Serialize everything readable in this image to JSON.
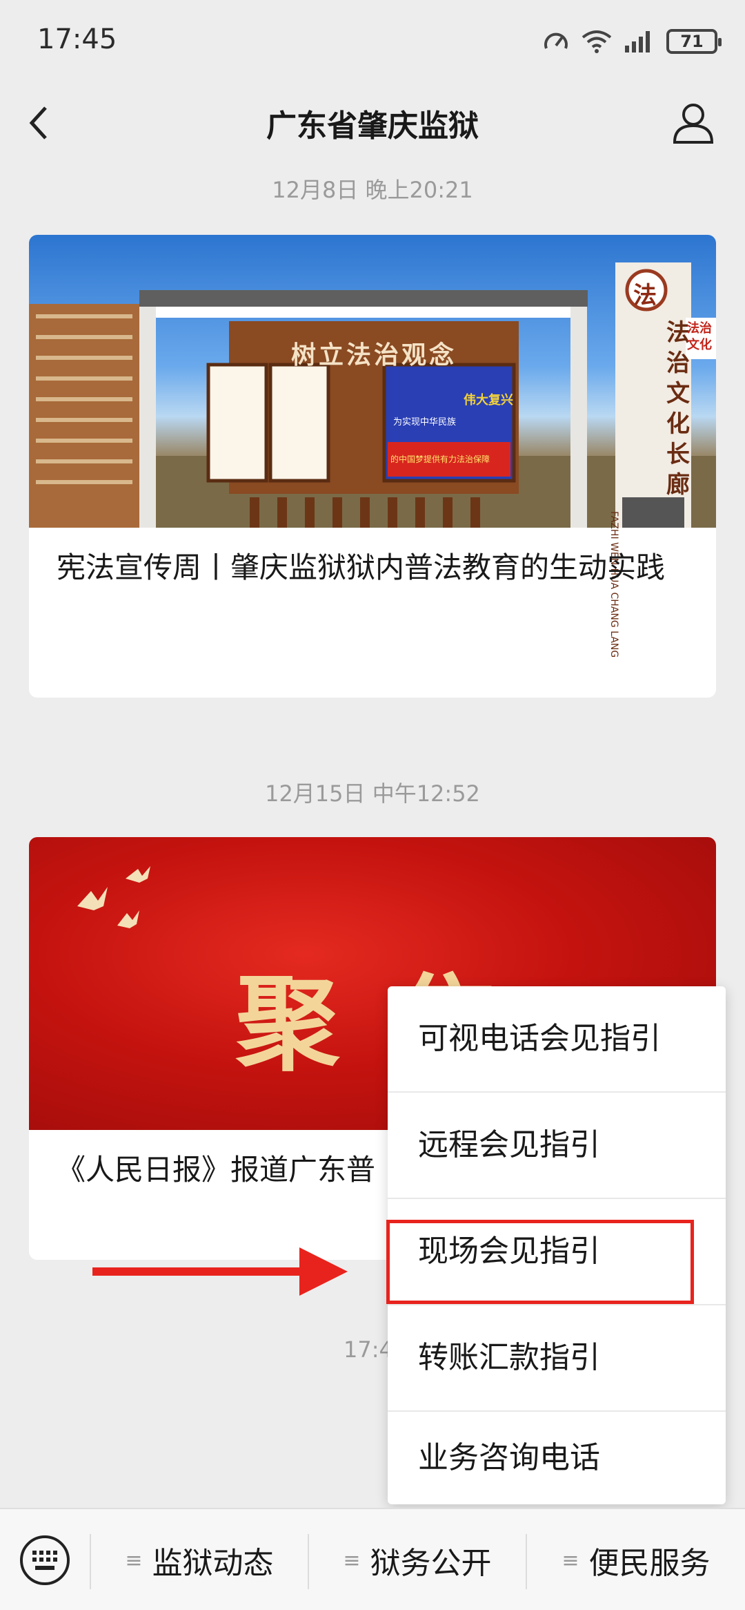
{
  "status": {
    "time": "17:45",
    "battery": "71"
  },
  "header": {
    "title": "广东省肇庆监狱"
  },
  "feed": [
    {
      "timestamp": "12月8日 晚上20:21",
      "title": "宪法宣传周丨肇庆监狱狱内普法教育的生动实践",
      "image_text": {
        "sign": "树立法治观念",
        "badge": "法",
        "side": "法治文化长廊",
        "side_pinyin": "FAZHI WEN HUA CHANG LANG",
        "corner": "法治文化",
        "poster_a": "为实现中华民族",
        "poster_b": "伟大复兴",
        "poster_c": "的中国梦提供有力法治保障"
      }
    },
    {
      "timestamp": "12月15日 中午12:52",
      "title": "《人民日报》报道广东普",
      "image_text": {
        "headline": "聚焦"
      }
    },
    {
      "timestamp": "17:4"
    }
  ],
  "menu": {
    "items": [
      "可视电话会见指引",
      "远程会见指引",
      "现场会见指引",
      "转账汇款指引",
      "业务咨询电话"
    ],
    "highlighted_index": 2
  },
  "annotation_color": "#e8231d",
  "bottom_nav": {
    "items": [
      "监狱动态",
      "狱务公开",
      "便民服务"
    ]
  }
}
